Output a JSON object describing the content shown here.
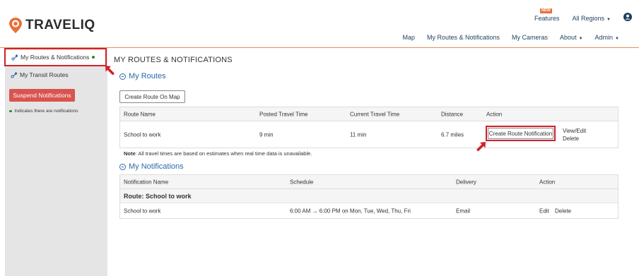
{
  "brand": {
    "name": "TRAVELIQ"
  },
  "topbar": {
    "new_badge": "NEW",
    "features": "Features",
    "regions": "All Regions"
  },
  "nav": {
    "map": "Map",
    "routes": "My Routes & Notifications",
    "cameras": "My Cameras",
    "about": "About",
    "admin": "Admin"
  },
  "sidebar": {
    "items": [
      {
        "label": "My Routes & Notifications"
      },
      {
        "label": "My Transit Routes"
      }
    ],
    "suspend_label": "Suspend Notifications",
    "hint": "Indicates there are notifications"
  },
  "page": {
    "title": "MY ROUTES & NOTIFICATIONS"
  },
  "routes": {
    "heading": "My Routes",
    "create_label": "Create Route On Map",
    "columns": [
      "Route Name",
      "Posted Travel Time",
      "Current Travel Time",
      "Distance",
      "Action"
    ],
    "rows": [
      {
        "name": "School to work",
        "posted": "9 min",
        "current": "11 min",
        "distance": "6.7 miles",
        "create_notification": "Create Route Notification",
        "view_edit": "View/Edit",
        "delete": "Delete"
      }
    ],
    "note_label": "Note",
    "note_text": ": All travel times are based on estimates when real time data is unavailable."
  },
  "notifications": {
    "heading": "My Notifications",
    "columns": [
      "Notification Name",
      "Schedule",
      "Delivery",
      "Action"
    ],
    "group": "Route: School to work",
    "rows": [
      {
        "name": "School to work",
        "schedule": "6:00 AM → 6:00 PM on Mon, Tue, Wed, Thu, Fri",
        "delivery": "Email",
        "edit": "Edit",
        "delete": "Delete"
      }
    ]
  },
  "colors": {
    "accent": "#e8703a",
    "link": "#1c3f5e",
    "heading_blue": "#2a6aa8",
    "danger": "#d9534f",
    "highlight_red": "#d0202a",
    "status_green": "#2a8a2a"
  },
  "icons": [
    "location-pin-logo-icon",
    "user-circle-icon",
    "route-icon",
    "transit-route-icon",
    "collapse-circle-icon",
    "annotation-arrow-icon"
  ]
}
